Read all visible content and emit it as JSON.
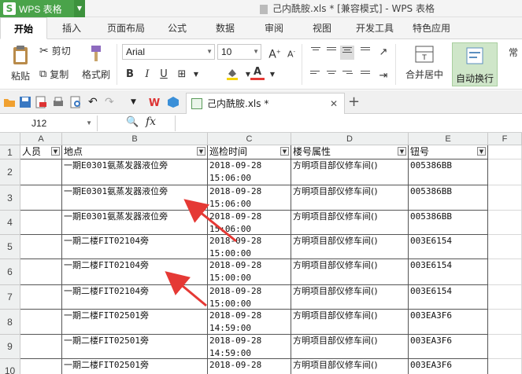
{
  "app": {
    "name": "WPS 表格",
    "doc_title": "己内酰胺.xls * [兼容模式] - WPS 表格"
  },
  "tabs": [
    "开始",
    "插入",
    "页面布局",
    "公式",
    "数据",
    "审阅",
    "视图",
    "开发工具",
    "特色应用"
  ],
  "ribbon": {
    "paste": "粘贴",
    "cut": "剪切",
    "copy": "复制",
    "format_painter": "格式刷",
    "font_name": "Arial",
    "font_size": "10",
    "merge": "合并居中",
    "wrap": "自动换行",
    "overflow_label": "常"
  },
  "doc_tab": {
    "name": "己内酰胺.xls *"
  },
  "formula_bar": {
    "cell_ref": "J12",
    "fx": "fx",
    "value": ""
  },
  "grid": {
    "columns": [
      "A",
      "B",
      "C",
      "D",
      "E",
      "F"
    ],
    "headers": [
      "人员",
      "地点",
      "巡检时间",
      "楼号属性",
      "钮号"
    ],
    "row_numbers": [
      "1",
      "2",
      "3",
      "4",
      "5",
      "6",
      "7",
      "8",
      "9",
      "10"
    ],
    "rows": [
      {
        "a": "",
        "b": "一期E0301氨蒸发器液位旁",
        "c1": "2018-09-28",
        "c2": "15:06:00",
        "d": "方明项目部仪修车间()",
        "e": "005386BB"
      },
      {
        "a": "",
        "b": "一期E0301氨蒸发器液位旁",
        "c1": "2018-09-28",
        "c2": "15:06:00",
        "d": "方明项目部仪修车间()",
        "e": "005386BB"
      },
      {
        "a": "",
        "b": "一期E0301氨蒸发器液位旁",
        "c1": "2018-09-28",
        "c2": "15:06:00",
        "d": "方明项目部仪修车间()",
        "e": "005386BB"
      },
      {
        "a": "",
        "b": "一期二楼FIT02104旁",
        "c1": "2018-09-28",
        "c2": "15:00:00",
        "d": "方明项目部仪修车间()",
        "e": "003E6154"
      },
      {
        "a": "",
        "b": "一期二楼FIT02104旁",
        "c1": "2018-09-28",
        "c2": "15:00:00",
        "d": "方明项目部仪修车间()",
        "e": "003E6154"
      },
      {
        "a": "",
        "b": "一期二楼FIT02104旁",
        "c1": "2018-09-28",
        "c2": "15:00:00",
        "d": "方明项目部仪修车间()",
        "e": "003E6154"
      },
      {
        "a": "",
        "b": "一期二楼FIT02501旁",
        "c1": "2018-09-28",
        "c2": "14:59:00",
        "d": "方明项目部仪修车间()",
        "e": "003EA3F6"
      },
      {
        "a": "",
        "b": "一期二楼FIT02501旁",
        "c1": "2018-09-28",
        "c2": "14:59:00",
        "d": "方明项目部仪修车间()",
        "e": "003EA3F6"
      },
      {
        "a": "",
        "b": "一期二楼FIT02501旁",
        "c1": "2018-09-28",
        "c2": "",
        "d": "方明项目部仪修车间()",
        "e": "003EA3F6"
      }
    ]
  },
  "colors": {
    "accent": "#4aa34a",
    "arrow": "#e53935"
  }
}
